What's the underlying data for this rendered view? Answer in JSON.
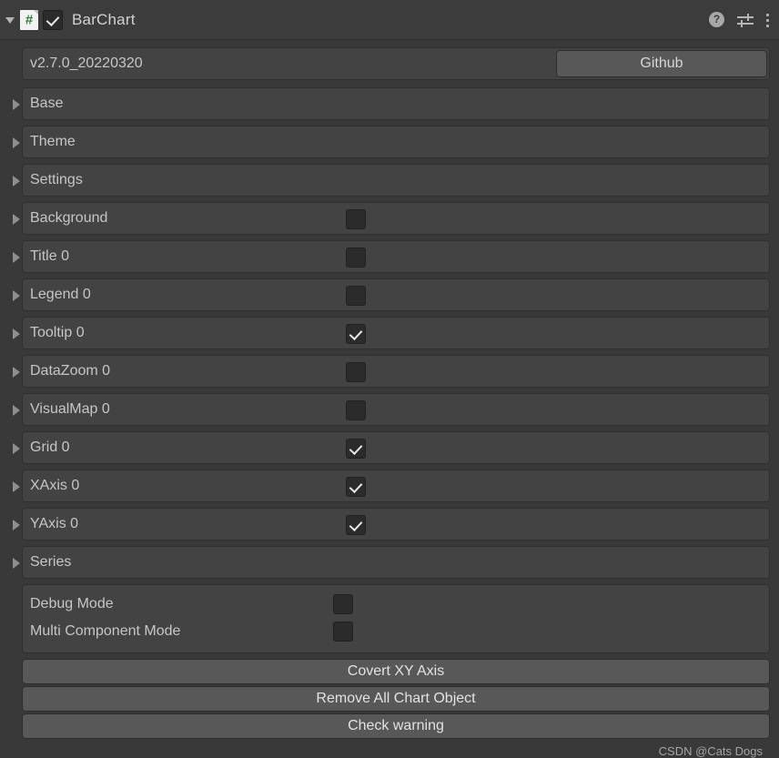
{
  "header": {
    "foldout_icon": "triangle-down-icon",
    "script_icon": "csharp-script-icon",
    "enabled": true,
    "title": "BarChart",
    "help_icon": "?",
    "help_icon_name": "help-icon",
    "preset_icon_name": "preset-icon",
    "menu_icon_name": "more-menu-icon"
  },
  "version": {
    "value": "v2.7.0_20220320",
    "github_label": "Github"
  },
  "sections": [
    {
      "label": "Base",
      "has_checkbox": false,
      "checked": false
    },
    {
      "label": "Theme",
      "has_checkbox": false,
      "checked": false
    },
    {
      "label": "Settings",
      "has_checkbox": false,
      "checked": false
    },
    {
      "label": "Background",
      "has_checkbox": true,
      "checked": false
    },
    {
      "label": "Title 0",
      "has_checkbox": true,
      "checked": false
    },
    {
      "label": "Legend 0",
      "has_checkbox": true,
      "checked": false
    },
    {
      "label": "Tooltip 0",
      "has_checkbox": true,
      "checked": true
    },
    {
      "label": "DataZoom 0",
      "has_checkbox": true,
      "checked": false
    },
    {
      "label": "VisualMap 0",
      "has_checkbox": true,
      "checked": false
    },
    {
      "label": "Grid 0",
      "has_checkbox": true,
      "checked": true
    },
    {
      "label": "XAxis 0",
      "has_checkbox": true,
      "checked": true
    },
    {
      "label": "YAxis 0",
      "has_checkbox": true,
      "checked": true
    },
    {
      "label": "Series",
      "has_checkbox": false,
      "checked": false
    }
  ],
  "modes": [
    {
      "label": "Debug Mode",
      "checked": false
    },
    {
      "label": "Multi Component Mode",
      "checked": false
    }
  ],
  "actions": [
    {
      "label": "Covert XY Axis"
    },
    {
      "label": "Remove All Chart Object"
    },
    {
      "label": "Check warning"
    }
  ],
  "watermark": "CSDN @Cats Dogs",
  "colors": {
    "window_bg": "#393939",
    "header_bg": "#3c3c3c",
    "panel_bg": "#434343",
    "panel_border": "#303030",
    "button_bg": "#585858",
    "text": "#c6c6c6",
    "script_icon_accent": "#2e7d32"
  }
}
